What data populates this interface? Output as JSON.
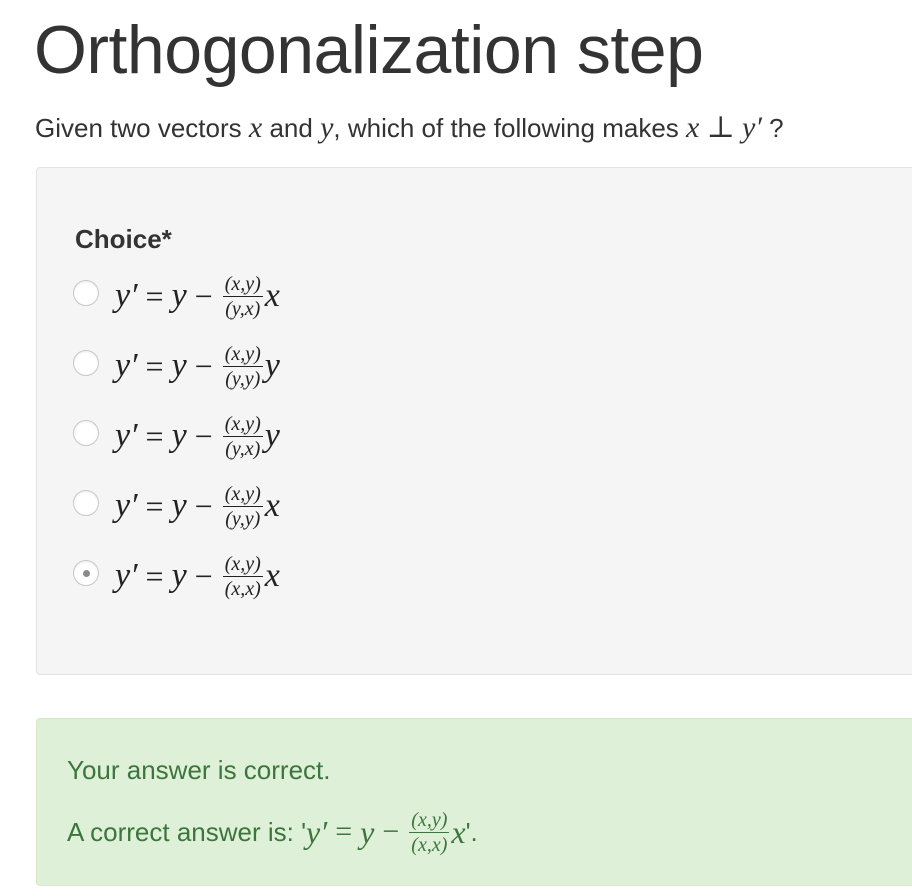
{
  "page": {
    "title": "Orthogonalization step"
  },
  "question": {
    "text_before": "Given two vectors",
    "var_x": "x",
    "text_and": "and",
    "var_y": "y",
    "text_after": ", which of the following makes",
    "perp_expr_x": "x",
    "perp_symbol": "⊥",
    "perp_expr_y": "y′",
    "question_mark": "?"
  },
  "form": {
    "field_label": "Choice*",
    "choices": [
      {
        "lhs": "y′",
        "eq": "=",
        "y": "y",
        "minus": "−",
        "num": "(x,y)",
        "den": "(y,x)",
        "mult": "x",
        "selected": false
      },
      {
        "lhs": "y′",
        "eq": "=",
        "y": "y",
        "minus": "−",
        "num": "(x,y)",
        "den": "(y,y)",
        "mult": "y",
        "selected": false
      },
      {
        "lhs": "y′",
        "eq": "=",
        "y": "y",
        "minus": "−",
        "num": "(x,y)",
        "den": "(y,x)",
        "mult": "y",
        "selected": false
      },
      {
        "lhs": "y′",
        "eq": "=",
        "y": "y",
        "minus": "−",
        "num": "(x,y)",
        "den": "(y,y)",
        "mult": "x",
        "selected": false
      },
      {
        "lhs": "y′",
        "eq": "=",
        "y": "y",
        "minus": "−",
        "num": "(x,y)",
        "den": "(x,x)",
        "mult": "x",
        "selected": true
      }
    ]
  },
  "feedback": {
    "status_message": "Your answer is correct.",
    "answer_prefix": "A correct answer is: '",
    "answer_lhs": "y′",
    "answer_eq": "=",
    "answer_y": "y",
    "answer_minus": "−",
    "answer_num": "(x,y)",
    "answer_den": "(x,x)",
    "answer_mult": "x",
    "answer_suffix": "'.",
    "colors": {
      "background": "#dff0d8",
      "text": "#3c763d"
    }
  },
  "colors": {
    "panel_background": "#f5f5f5",
    "text": "#333333"
  }
}
